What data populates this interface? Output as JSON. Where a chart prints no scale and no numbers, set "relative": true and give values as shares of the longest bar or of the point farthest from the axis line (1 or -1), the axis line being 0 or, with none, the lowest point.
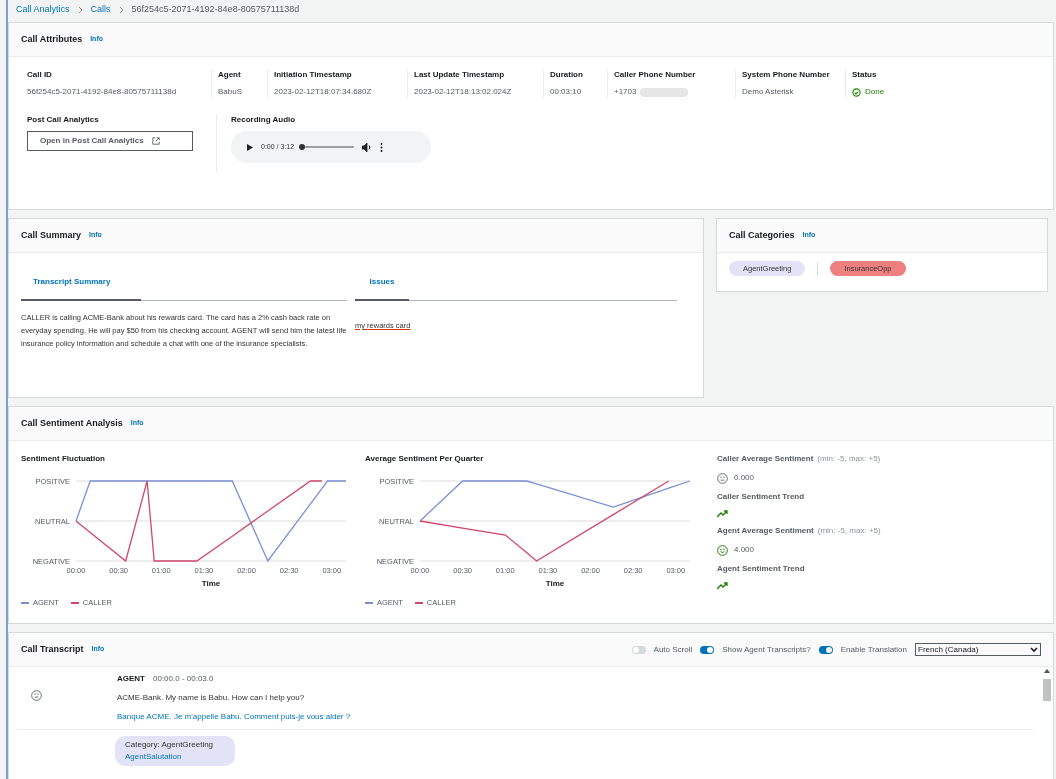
{
  "breadcrumb": [
    "Call Analytics",
    "Calls",
    "56f254c5-2071-4192-84e8-80575711138d"
  ],
  "call_attributes": {
    "title": "Call Attributes",
    "info": "Info",
    "fields": [
      {
        "label": "Call ID",
        "value": "56f254c5-2071-4192-84e8-80575711138d"
      },
      {
        "label": "Agent",
        "value": "BabuS"
      },
      {
        "label": "Initiation Timestamp",
        "value": "2023-02-12T18:07:34.680Z"
      },
      {
        "label": "Last Update Timestamp",
        "value": "2023-02-12T18:13:02.024Z"
      },
      {
        "label": "Duration",
        "value": "00:03:10"
      },
      {
        "label": "Caller Phone Number",
        "value": "+1703",
        "redacted": true
      },
      {
        "label": "System Phone Number",
        "value": "Demo Asterisk"
      },
      {
        "label": "Status",
        "value": "Done",
        "kind": "status"
      }
    ],
    "post_call": {
      "label": "Post Call Analytics",
      "button": "Open in Post Call Analytics"
    },
    "recording": {
      "label": "Recording Audio",
      "time": "0:00 / 3:12",
      "level": 0
    }
  },
  "call_summary": {
    "title": "Call Summary",
    "info": "Info",
    "tabs": [
      {
        "label": "Transcript Summary",
        "text": "CALLER is calling ACME-Bank about his rewards card. The card has a 2% cash back rate on everyday spending. He will pay $50 from his checking account. AGENT will send him the latest life insurance policy information and schedule a chat with one of the insurance specialists."
      },
      {
        "label": "Issues",
        "text": "my rewards card"
      }
    ]
  },
  "call_categories": {
    "title": "Call Categories",
    "info": "Info",
    "items": [
      {
        "label": "AgentGreeting",
        "color": "#e3e3f7"
      },
      {
        "label": "InsuranceOpp",
        "color": "#f08080"
      }
    ]
  },
  "sentiment": {
    "title": "Call Sentiment Analysis",
    "info": "Info",
    "charts": [
      {
        "chart_data": {
          "type": "line",
          "title": "Sentiment Fluctuation",
          "xlabel": "Time",
          "x": [
            0,
            10,
            35,
            50,
            55,
            85,
            110,
            135,
            165,
            173,
            177,
            190
          ],
          "series": [
            {
              "name": "AGENT",
              "color": "#7b8fd6",
              "values": [
                0,
                1,
                1,
                1,
                1,
                1,
                1,
                -1,
                0.43,
                0.81,
                1,
                1
              ]
            },
            {
              "name": "CALLER",
              "color": "#d0476a",
              "values": [
                0,
                -0.29,
                -1,
                1,
                -1,
                -1,
                -0.38,
                0.25,
                1,
                1,
                null,
                null
              ]
            }
          ],
          "xlim": [
            0,
            190
          ],
          "relative": true,
          "legend": "bottom",
          "xticks": [
            {
              "value": 0,
              "label": "00:00"
            },
            {
              "value": 30,
              "label": "00:30"
            },
            {
              "value": 60,
              "label": "01:00"
            },
            {
              "value": 90,
              "label": "01:30"
            },
            {
              "value": 120,
              "label": "02:00"
            },
            {
              "value": 150,
              "label": "02:30"
            },
            {
              "value": 180,
              "label": "03:00"
            }
          ]
        },
        "y_labels": [
          "POSITIVE",
          "NEUTRAL",
          "NEGATIVE"
        ]
      },
      {
        "chart_data": {
          "type": "line",
          "title": "Average Sentiment Per Quarter",
          "xlabel": "Time",
          "x": [
            0,
            30,
            60,
            75,
            82,
            136,
            175,
            190
          ],
          "series": [
            {
              "name": "AGENT",
              "color": "#7b8fd6",
              "values": [
                0,
                1,
                1,
                1,
                0.93,
                0.35,
                0.82,
                1
              ]
            },
            {
              "name": "CALLER",
              "color": "#d0476a",
              "values": [
                0,
                -0.18,
                -0.35,
                -0.79,
                -1,
                0.16,
                1,
                null
              ]
            }
          ],
          "xlim": [
            0,
            190
          ],
          "relative": true,
          "legend": "bottom",
          "xticks": [
            {
              "value": 0,
              "label": "00:00"
            },
            {
              "value": 30,
              "label": "00:30"
            },
            {
              "value": 60,
              "label": "01:00"
            },
            {
              "value": 90,
              "label": "01:30"
            },
            {
              "value": 120,
              "label": "02:00"
            },
            {
              "value": 150,
              "label": "02:30"
            },
            {
              "value": 180,
              "label": "03:00"
            }
          ]
        },
        "y_labels": [
          "POSITIVE",
          "NEUTRAL",
          "NEGATIVE"
        ]
      }
    ],
    "stats": [
      {
        "label": "Caller Average Sentiment",
        "range": "(min: -5, max: +5)",
        "value": "0.000",
        "kind": "neutral",
        "trend_label": "Caller Sentiment Trend"
      },
      {
        "label": "Agent Average Sentiment",
        "range": "(min: -5, max: +5)",
        "value": "4.000",
        "kind": "positive",
        "trend_label": "Agent Sentiment Trend"
      }
    ]
  },
  "call_transcript": {
    "title": "Call Transcript",
    "info": "Info",
    "toggles": [
      {
        "label": "Auto Scroll",
        "on": false
      },
      {
        "label": "Show Agent Transcripts?",
        "on": true
      },
      {
        "label": "Enable Translation",
        "on": true
      }
    ],
    "language": "French (Canada)",
    "entries": [
      {
        "speaker": "AGENT",
        "time": "00:00.0 - 00:03.0",
        "text": "ACME-Bank. My name is Babu. How can I help you?",
        "translation": "Banque ACME. Je m'appelle Babu. Comment puis-je vous aider ?",
        "category": "Category: AgentGreeting",
        "subcategory": "AgentSalutation"
      }
    ]
  }
}
